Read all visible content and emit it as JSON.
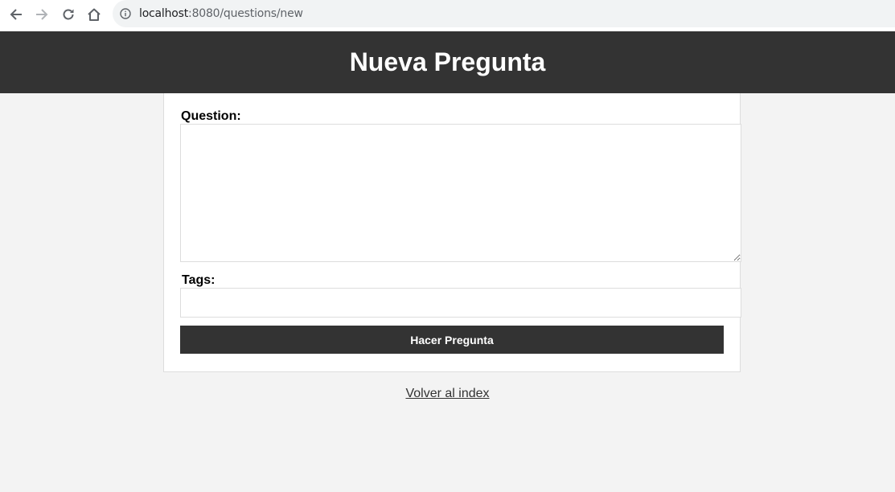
{
  "browser": {
    "url_host": "localhost",
    "url_rest": ":8080/questions/new",
    "icons": {
      "back": "arrow-left-icon",
      "forward": "arrow-right-icon",
      "reload": "reload-icon",
      "home": "home-icon",
      "info": "info-icon"
    }
  },
  "header": {
    "title": "Nueva Pregunta",
    "background": "#333333",
    "text_color": "#ffffff"
  },
  "form": {
    "question_label": "Question:",
    "question_value": "",
    "tags_label": "Tags:",
    "tags_value": "",
    "submit_label": "Hacer Pregunta",
    "submit_color": "#333333"
  },
  "footer": {
    "back_link_label": "Volver al index"
  }
}
